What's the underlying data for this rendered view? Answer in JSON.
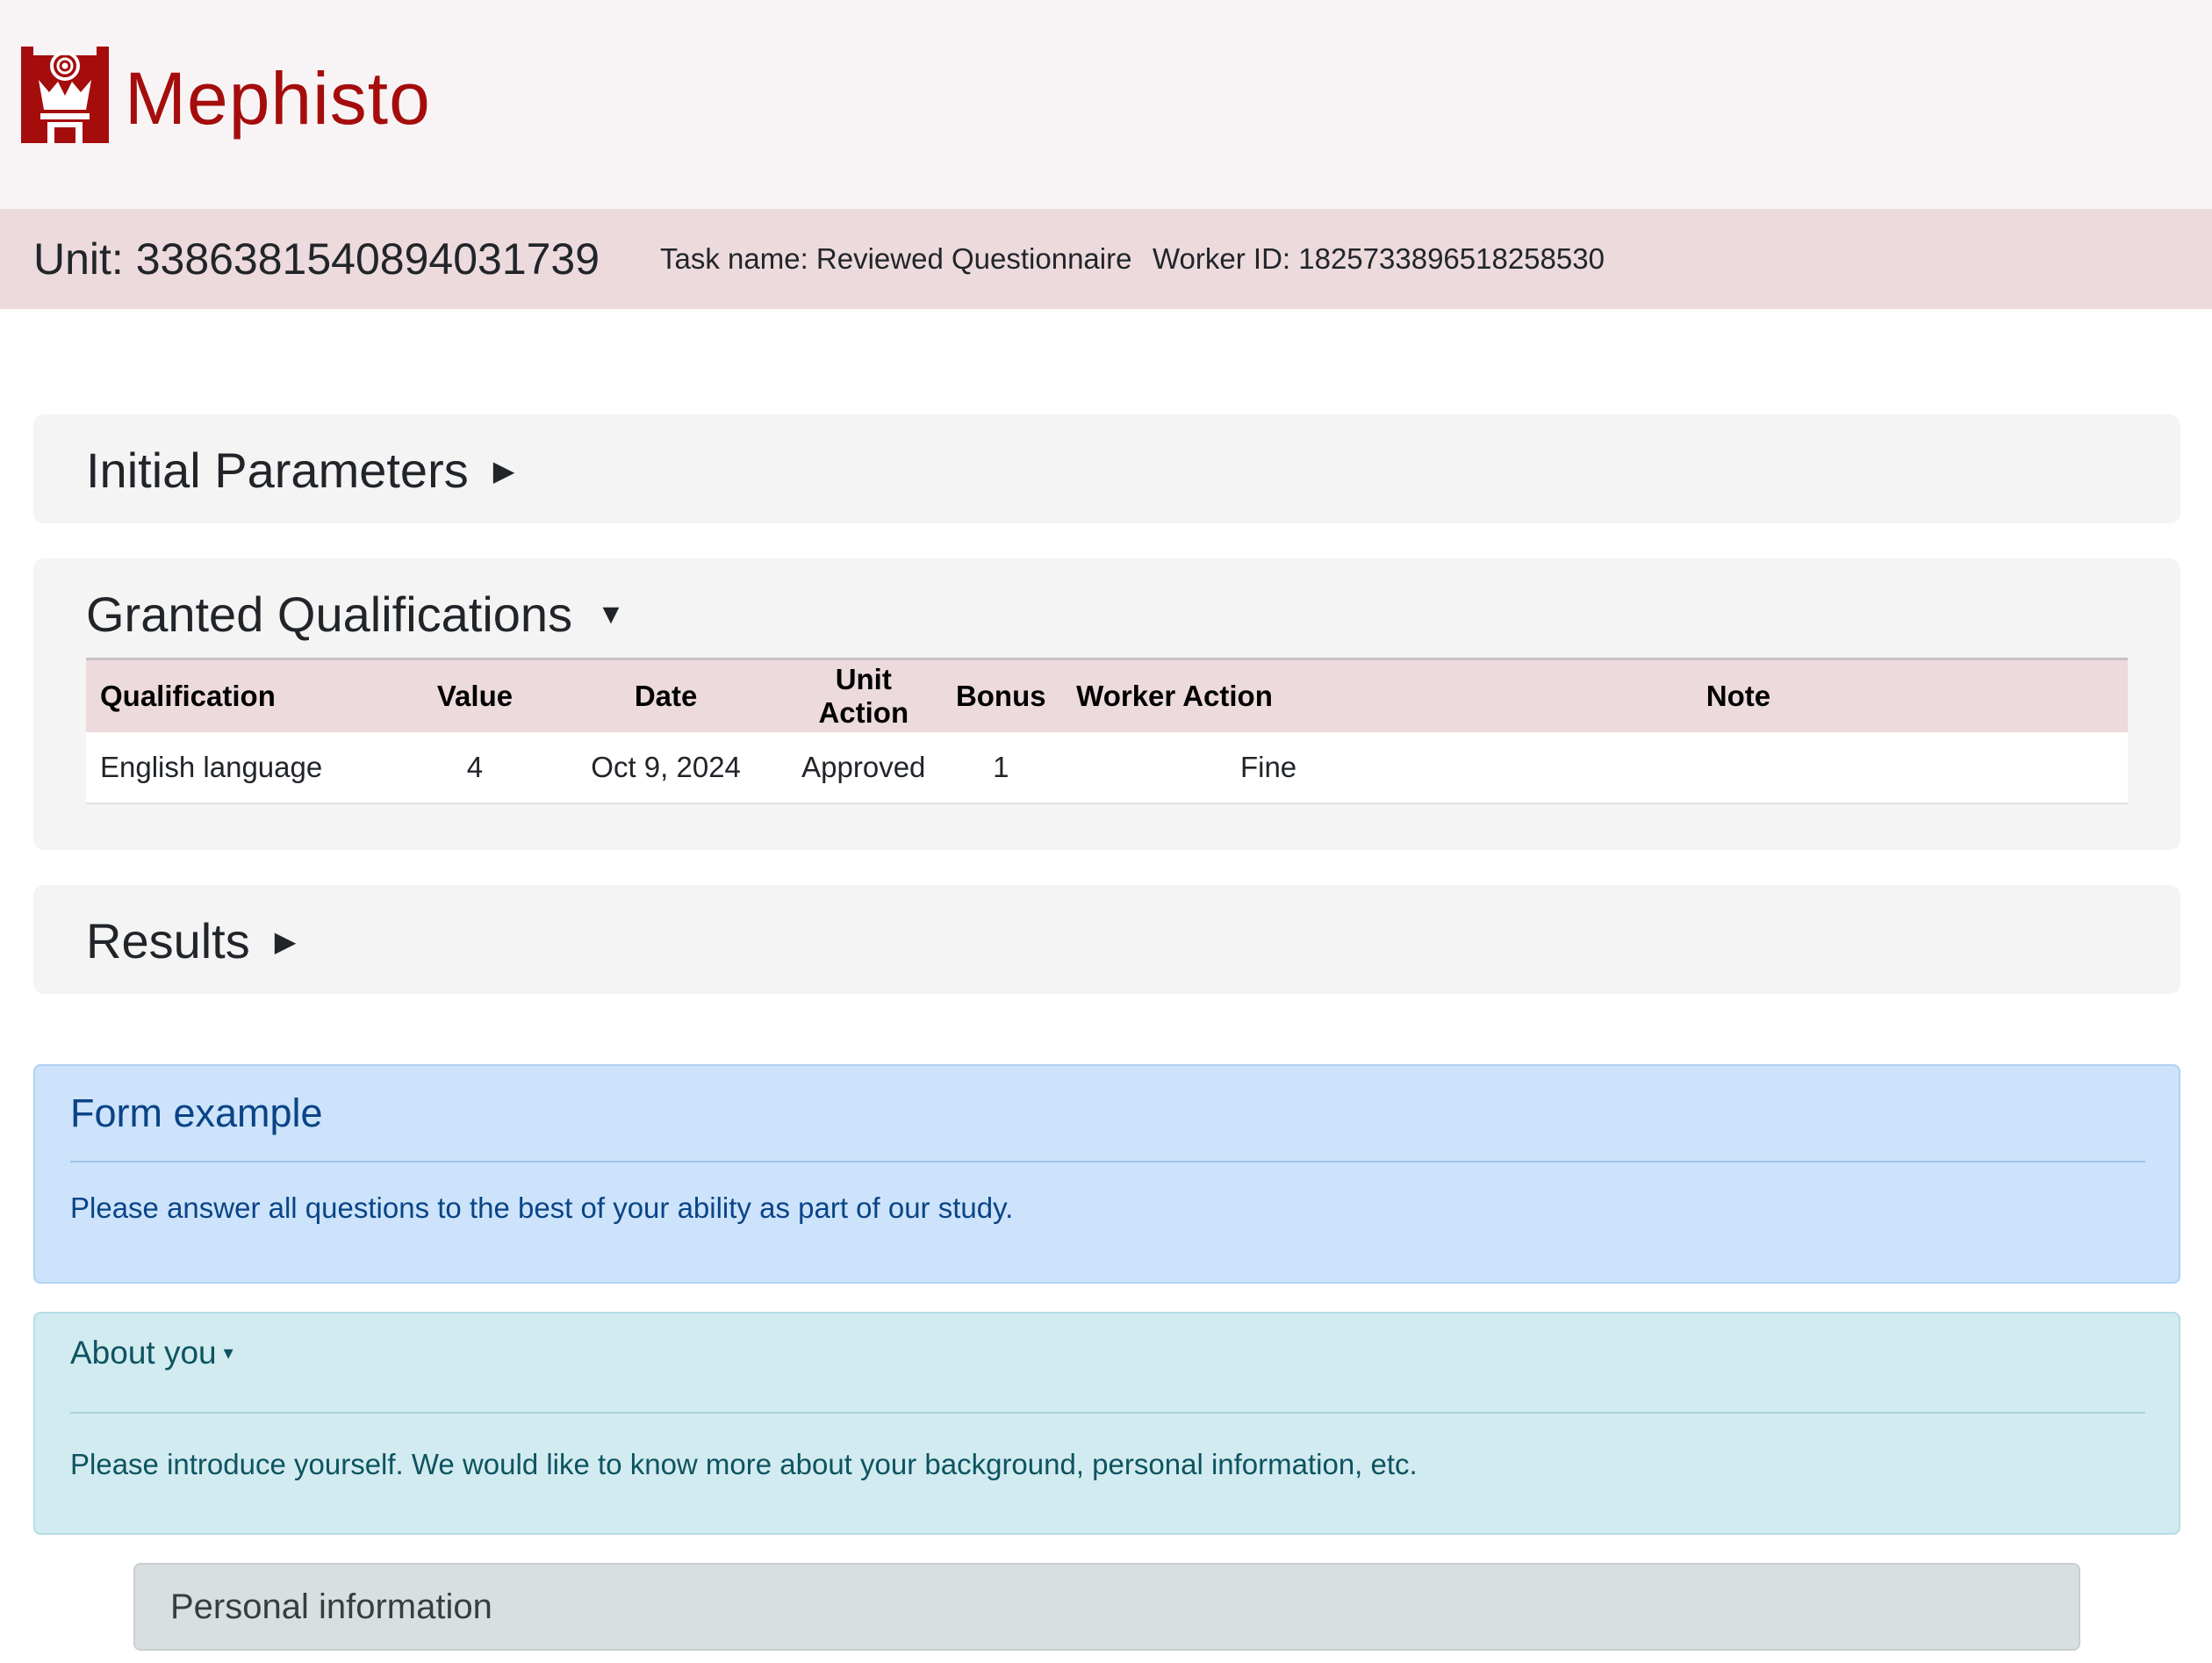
{
  "brand": {
    "name": "Mephisto",
    "logo_icon": "mephisto-tower-logo-icon",
    "color": "#a50d0d"
  },
  "unit_bar": {
    "unit_label": "Unit: 3386381540894031739",
    "task_name": "Task name: Reviewed Questionnaire",
    "worker_id": "Worker ID: 1825733896518258530"
  },
  "sections": {
    "initial_parameters": {
      "title": "Initial Parameters",
      "caret": "▶"
    },
    "granted_qualifications": {
      "title": "Granted Qualifications",
      "caret": "▼"
    },
    "results": {
      "title": "Results",
      "caret": "▶"
    }
  },
  "qualifications_table": {
    "headers": [
      "Qualification",
      "Value",
      "Date",
      "Unit Action",
      "Bonus",
      "Worker Action",
      "Note"
    ],
    "rows": [
      {
        "qualification": "English language",
        "value": "4",
        "date": "Oct 9, 2024",
        "unit_action": "Approved",
        "bonus": "1",
        "worker_action": "Fine",
        "note": ""
      }
    ],
    "status_colors": {
      "approved": "#1f8a4c"
    }
  },
  "form_example": {
    "title": "Form example",
    "text": "Please answer all questions to the best of your ability as part of our study."
  },
  "about_you": {
    "title": "About you",
    "caret": "▾",
    "text": "Please introduce yourself. We would like to know more about your background, personal information, etc."
  },
  "personal_information": {
    "title": "Personal information"
  }
}
